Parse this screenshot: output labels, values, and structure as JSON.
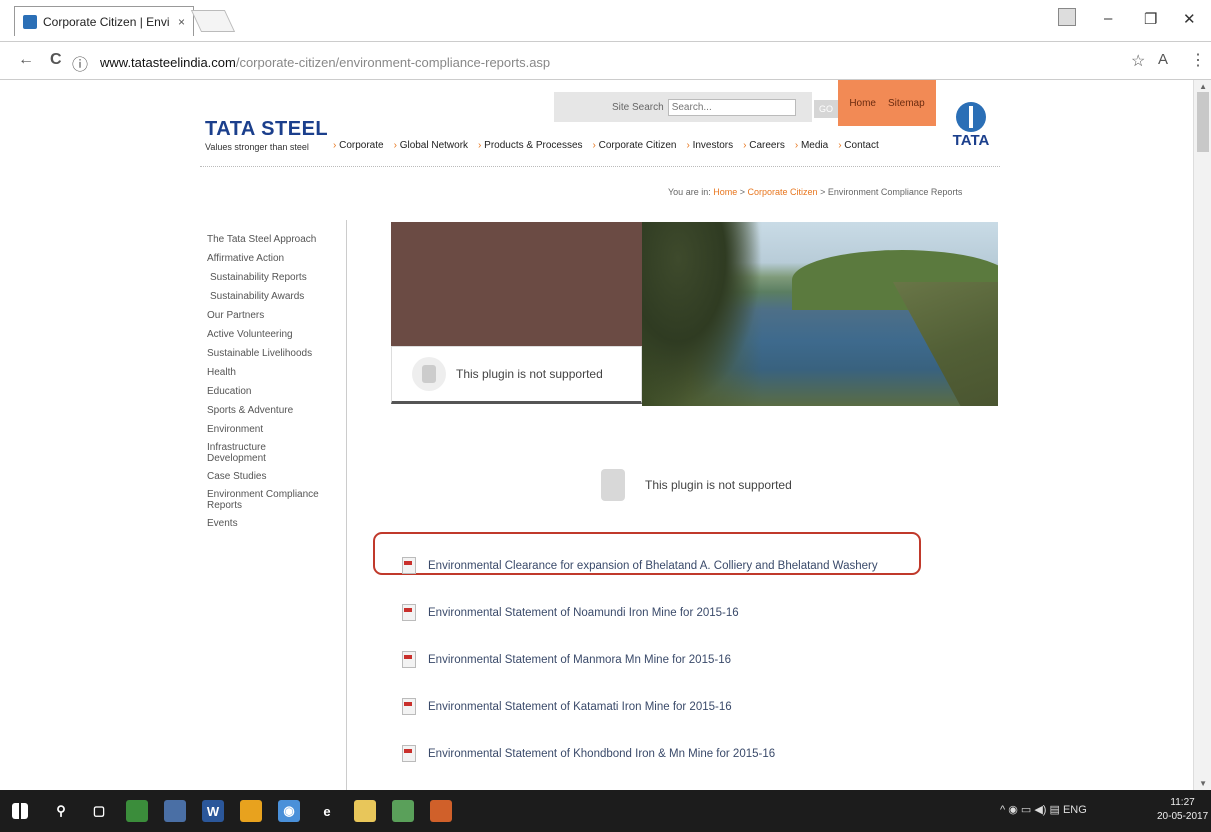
{
  "browser": {
    "tab_title": "Corporate Citizen | Envi",
    "tab_close": "×",
    "url_host": "www.tatasteelindia.com",
    "url_path": "/corporate-citizen/environment-compliance-reports.asp",
    "window_controls": {
      "minimize": "–",
      "restore": "❐",
      "close": "✕"
    },
    "nav": {
      "back": "←",
      "reload": "C",
      "info": "ⓘ"
    },
    "star": "☆",
    "extension": "A",
    "menu": "⋮"
  },
  "header": {
    "logo_text": "TATA STEEL",
    "logo_tagline": "Values stronger than steel",
    "site_search_label": "Site Search",
    "search_placeholder": "Search...",
    "go_label": "GO",
    "top_links": [
      "Home",
      "Sitemap"
    ],
    "tata_text": "TATA",
    "nav_items": [
      "Corporate",
      "Global Network",
      "Products & Processes",
      "Corporate Citizen",
      "Investors",
      "Careers",
      "Media",
      "Contact"
    ]
  },
  "breadcrumb": {
    "prefix": "You are in:",
    "home": "Home",
    "sep": ">",
    "section": "Corporate Citizen",
    "current": "Environment Compliance Reports"
  },
  "left_menu": [
    "The Tata Steel Approach",
    "Affirmative Action",
    "Sustainability Reports",
    "Sustainability Awards",
    "Our Partners",
    "Active Volunteering",
    "Sustainable Livelihoods",
    "Health",
    "Education",
    "Sports & Adventure",
    "Environment",
    "Infrastructure Development",
    "Case Studies",
    "Environment Compliance Reports",
    "Events"
  ],
  "plugin_message": "This plugin is not supported",
  "reports": [
    "Environmental Clearance for expansion of Bhelatand A. Colliery and Bhelatand Washery",
    "Environmental Statement of Noamundi Iron Mine for 2015-16",
    "Environmental Statement of Manmora Mn Mine for 2015-16",
    "Environmental Statement of Katamati Iron Mine for 2015-16",
    "Environmental Statement of Khondbond Iron & Mn Mine for 2015-16"
  ],
  "taskbar": {
    "tray": "^ ◉ ▭ ◀) ▤ ENG",
    "time": "11:27",
    "date": "20-05-2017",
    "icons": [
      {
        "name": "search-icon",
        "color": "#1c1c1c",
        "glyph": "⚲"
      },
      {
        "name": "task-view-icon",
        "color": "#1c1c1c",
        "glyph": "▢"
      },
      {
        "name": "store-icon",
        "color": "#3b8d3b",
        "glyph": ""
      },
      {
        "name": "people-icon",
        "color": "#4a6fa5",
        "glyph": ""
      },
      {
        "name": "word-icon",
        "color": "#2b579a",
        "glyph": "W"
      },
      {
        "name": "app-orange-icon",
        "color": "#e8a21e",
        "glyph": ""
      },
      {
        "name": "chrome-icon",
        "color": "#4a90d9",
        "glyph": "◉"
      },
      {
        "name": "edge-icon",
        "color": "#1c1c1c",
        "glyph": "e"
      },
      {
        "name": "explorer-icon",
        "color": "#e8c65a",
        "glyph": ""
      },
      {
        "name": "app-green-icon",
        "color": "#5aa05a",
        "glyph": ""
      },
      {
        "name": "app-red-icon",
        "color": "#d0602a",
        "glyph": ""
      }
    ]
  }
}
